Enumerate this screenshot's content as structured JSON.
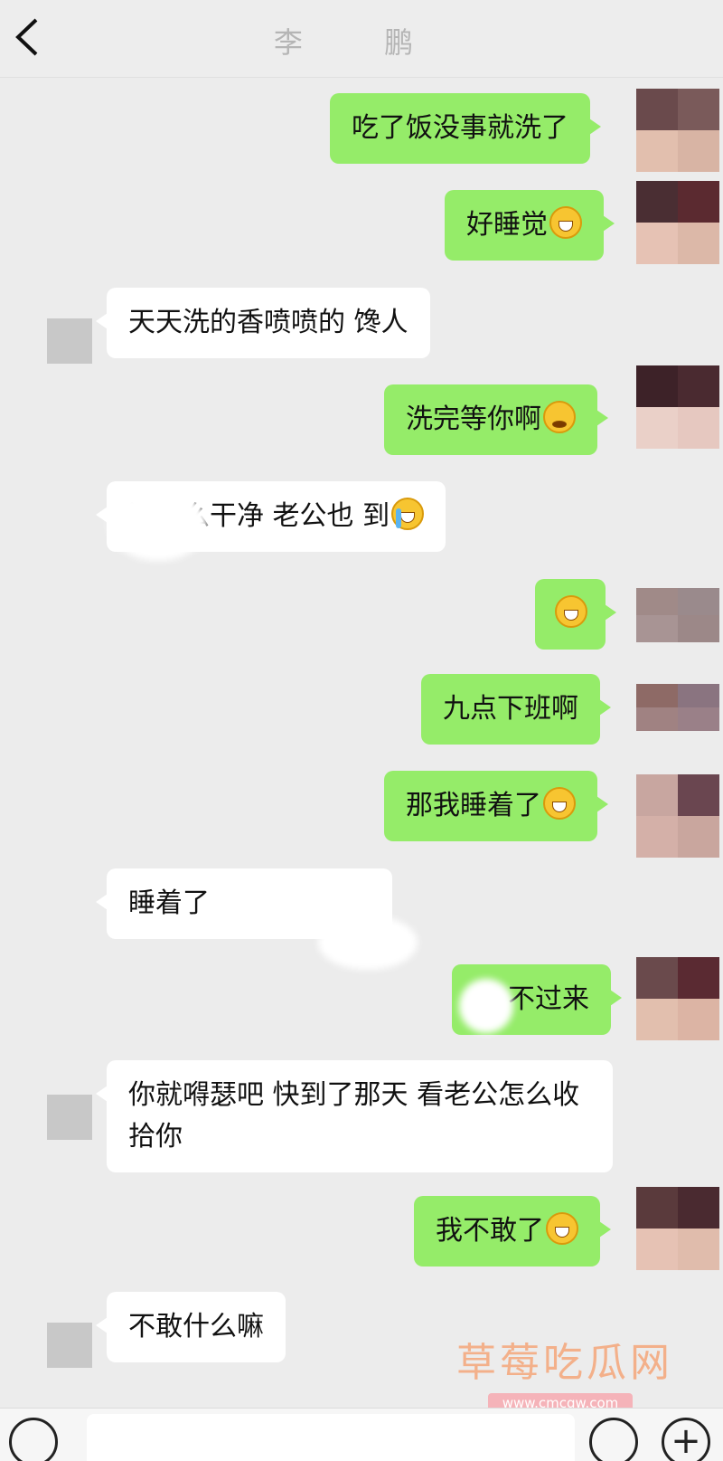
{
  "header": {
    "title": "李  鹏"
  },
  "messages": [
    {
      "side": "out",
      "text": "吃了饭没事就洗了",
      "emoji": ""
    },
    {
      "side": "out",
      "text": "好睡觉",
      "emoji": "grin"
    },
    {
      "side": "in",
      "text": "天天洗的香喷喷的 馋人",
      "emoji": ""
    },
    {
      "side": "out",
      "text": "洗完等你啊",
      "emoji": "thinking"
    },
    {
      "side": "in",
      "text": "洗那么干净 老公也   到",
      "emoji": "crying"
    },
    {
      "side": "out",
      "text": "",
      "emoji": "facepalm"
    },
    {
      "side": "out",
      "text": "九点下班啊",
      "emoji": ""
    },
    {
      "side": "out",
      "text": "那我睡着了",
      "emoji": "grin"
    },
    {
      "side": "in",
      "text": "睡着了",
      "emoji": ""
    },
    {
      "side": "out",
      "text": "不过来",
      "emoji": ""
    },
    {
      "side": "in",
      "text": "你就嘚瑟吧 快到了那天 看老公怎么收拾你",
      "emoji": ""
    },
    {
      "side": "out",
      "text": "我不敢了",
      "emoji": "grin"
    },
    {
      "side": "in",
      "text": "不敢什么嘛",
      "emoji": ""
    }
  ],
  "watermark": {
    "text": "草莓吃瓜网",
    "url": "www.cmcgw.com"
  },
  "inputbar": {
    "plus": "+"
  },
  "icons": {
    "back": "chevron-left-icon",
    "voice": "voice-icon",
    "emoji": "smiley-icon",
    "plus": "plus-icon"
  },
  "colors": {
    "outgoing": "#95ec69",
    "incoming": "#ffffff",
    "background": "#ececec"
  }
}
